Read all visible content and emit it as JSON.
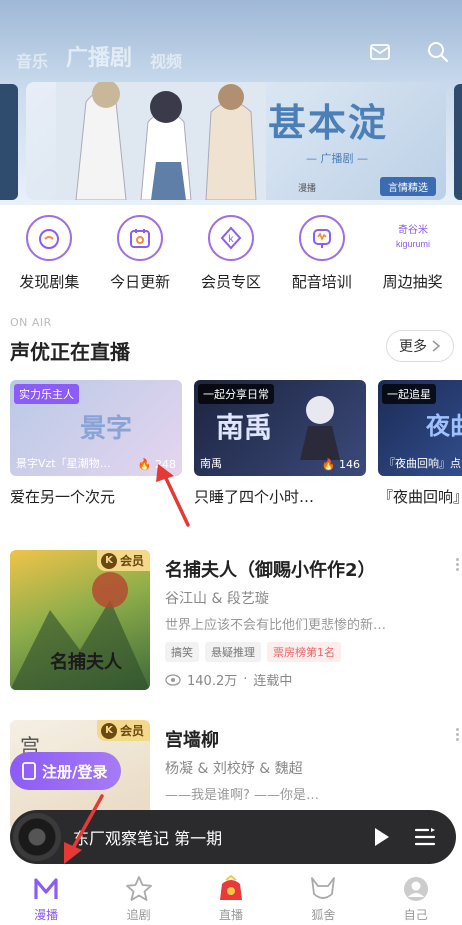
{
  "header": {
    "tabs": [
      {
        "label": "音乐"
      },
      {
        "label": "广播剧"
      },
      {
        "label": "视频"
      }
    ],
    "icons": [
      "mail-icon",
      "search-icon"
    ]
  },
  "banner": {
    "title": "甚本淀",
    "subtitle": "— 广播剧 —",
    "logo": "漫播",
    "tag": "言情精选"
  },
  "quick_entries": [
    {
      "label": "发现剧集",
      "icon": "discover-icon"
    },
    {
      "label": "今日更新",
      "icon": "calendar-icon"
    },
    {
      "label": "会员专区",
      "icon": "vip-icon"
    },
    {
      "label": "配音培训",
      "icon": "microphone-icon"
    },
    {
      "label": "周边抽奖",
      "icon": "gift-icon",
      "badge": "奇谷米 kigurumi"
    }
  ],
  "live_section": {
    "eyebrow": "ON AIR",
    "title": "声优正在直播",
    "more_label": "更多",
    "cards": [
      {
        "badge": "实力乐主人",
        "host": "景字Vzt「星潮物…",
        "count": "248",
        "title": "爱在另一个次元",
        "cover_text": "景字",
        "bg1": "#b9c9e6",
        "bg2": "#e5d5ef"
      },
      {
        "badge": "一起分享日常",
        "host": "南禹",
        "count": "146",
        "title": "只睡了四个小时…",
        "cover_text": "南禹",
        "bg1": "#1d2440",
        "bg2": "#3b4a7a"
      },
      {
        "badge": "一起追星",
        "host": "『夜曲回响』点",
        "count": "",
        "title": "『夜曲回响』",
        "cover_text": "夜曲",
        "bg1": "#1b2b55",
        "bg2": "#3d5fa8"
      }
    ]
  },
  "dramas": [
    {
      "title": "名捕夫人（御赐小仵作2）",
      "cast": "谷江山 & 段艺璇",
      "desc": "世界上应该不会有比他们更悲惨的新…",
      "tags": [
        "搞笑",
        "悬疑推理"
      ],
      "hot_tag": "票房榜第1名",
      "plays": "140.2万",
      "status": "连载中",
      "vip_label": "会员",
      "cover_text": "名捕夫人"
    },
    {
      "title": "宫墙柳",
      "cast": "杨凝 & 刘校妤 & 魏超",
      "desc": "——我是谁啊? ——你是…",
      "tags": [],
      "hot_tag": "",
      "plays": "",
      "status": "",
      "vip_label": "会员",
      "cover_text": "宫"
    }
  ],
  "login_button": "注册/登录",
  "player": {
    "title": "东厂观察笔记 第一期"
  },
  "bottom_nav": [
    {
      "label": "漫播",
      "icon": "home-m-icon",
      "active": true
    },
    {
      "label": "追剧",
      "icon": "star-icon",
      "active": false
    },
    {
      "label": "直播",
      "icon": "live-bag-icon",
      "active": false
    },
    {
      "label": "狐舍",
      "icon": "fox-icon",
      "active": false
    },
    {
      "label": "自己",
      "icon": "profile-icon",
      "active": false
    }
  ],
  "colors": {
    "accent": "#8b5cf6",
    "hot": "#e66666",
    "vip": "#f5d98a"
  }
}
